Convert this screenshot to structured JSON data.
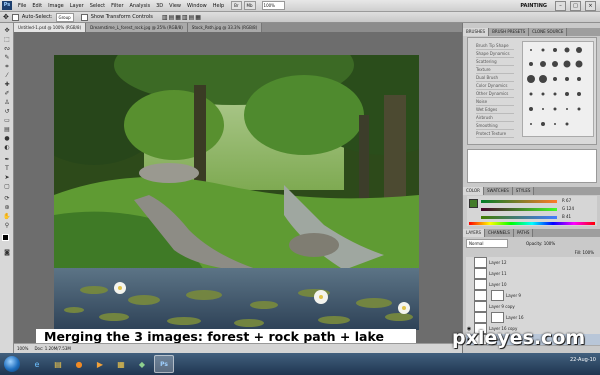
{
  "menubar": {
    "logo": "Ps",
    "items": [
      "File",
      "Edit",
      "Image",
      "Layer",
      "Select",
      "Filter",
      "Analysis",
      "3D",
      "View",
      "Window",
      "Help"
    ],
    "zoom": "100%",
    "workspace": "PAINTING"
  },
  "options": {
    "auto_select_label": "Auto-Select:",
    "auto_select_value": "Group",
    "show_transform_label": "Show Transform Controls"
  },
  "tabs": [
    {
      "label": "Untitled-1.psd @ 100% (RGB/8)",
      "active": true
    },
    {
      "label": "Dreamstime_L_forest_rock.jpg @ 25% (RGB/8)",
      "active": false
    },
    {
      "label": "Stock_Path.jpg @ 33.3% (RGB/8)",
      "active": false
    }
  ],
  "canvas": {
    "caption": "Merging the 3 images: forest + rock path + lake"
  },
  "status": {
    "zoom": "100%",
    "doc": "Doc: 1.20M/7.53M"
  },
  "panel": {
    "brushes_tabs": [
      "BRUSHES",
      "BRUSH PRESETS",
      "CLONE SOURCE"
    ],
    "brush_options": [
      "Brush Tip Shape",
      "Shape Dynamics",
      "Scattering",
      "Texture",
      "Dual Brush",
      "Color Dynamics",
      "Other Dynamics",
      "Noise",
      "Wet Edges",
      "Airbrush",
      "Smoothing",
      "Protect Texture"
    ],
    "color_tabs": [
      "COLOR",
      "SWATCHES",
      "STYLES"
    ],
    "color_values": [
      "R 67",
      "G 124",
      "B 41"
    ],
    "layers_tabs": [
      "LAYERS",
      "CHANNELS",
      "PATHS"
    ],
    "blend_mode": "Normal",
    "opacity": "Opacity: 100%",
    "fill": "Fill: 100%",
    "layers": [
      {
        "name": "Layer 12",
        "active": false,
        "visible": false
      },
      {
        "name": "Layer 11",
        "active": false,
        "visible": false
      },
      {
        "name": "Layer 10",
        "active": false,
        "visible": false
      },
      {
        "name": "Layer 9",
        "active": false,
        "visible": false
      },
      {
        "name": "Layer 9 copy",
        "active": false,
        "visible": false
      },
      {
        "name": "Layer 16",
        "active": false,
        "visible": false
      },
      {
        "name": "Layer 16 copy",
        "active": false,
        "visible": true
      },
      {
        "name": "Layer 15",
        "active": true,
        "visible": true
      }
    ]
  },
  "taskbar": {
    "time": "",
    "date": "22-Aug-10"
  },
  "watermark": "pxleyes.com"
}
